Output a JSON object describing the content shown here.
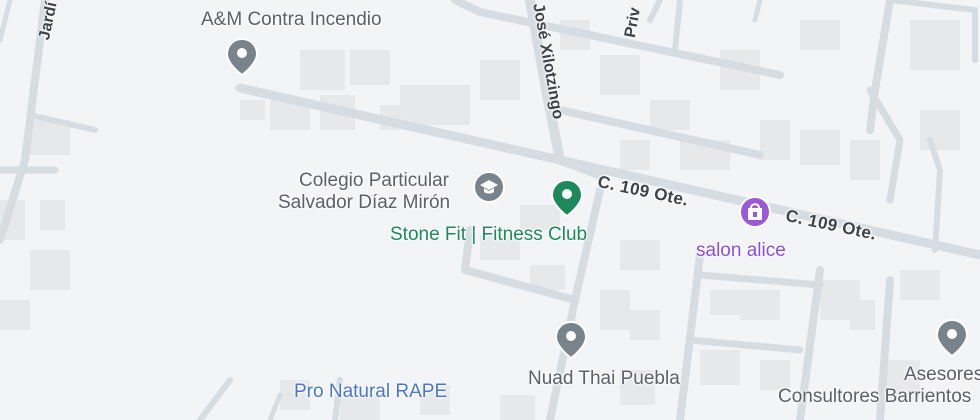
{
  "map": {
    "streets": {
      "jardin": "Jardí",
      "jose_xilotzingo": "José Xilotzingo",
      "privada": "Priv",
      "calle_109_a": "C. 109 Ote.",
      "calle_109_b": "C. 109 Ote."
    },
    "places": {
      "am_contra": "A&M Contra Incendio",
      "colegio_line1": "Colegio Particular",
      "colegio_line2": "Salvador Díaz Mirón",
      "stone_fit": "Stone Fit | Fitness Club",
      "salon_alice": "salon alice",
      "nuad_thai": "Nuad Thai Puebla",
      "asesores_line1": "Asesores",
      "asesores_line2": "Consultores Barrientos",
      "pro_natural": "Pro Natural RAPE"
    },
    "icons": {
      "am_contra": "generic-place-pin-icon",
      "colegio": "school-icon",
      "stone_fit": "fitness-pin-icon",
      "salon_alice": "shopping-pin-icon",
      "nuad_thai": "generic-place-pin-icon",
      "asesores": "generic-place-pin-icon"
    },
    "colors": {
      "background": "#f3f4f6",
      "road": "#d5dde3",
      "building": "#e7e8ea",
      "pin_gray": "#78838c",
      "pin_green": "#1e8a5c",
      "pin_purple": "#9b59d8",
      "text_green": "#1e8a5c",
      "text_purple": "#8d4ed9"
    }
  }
}
